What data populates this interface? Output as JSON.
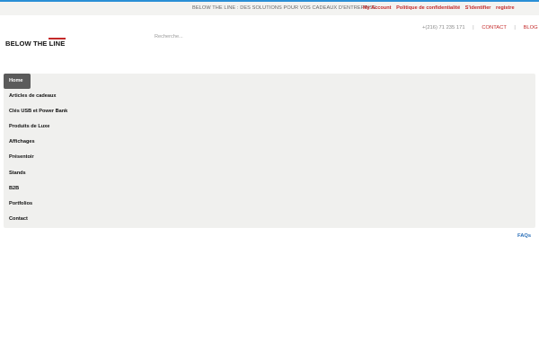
{
  "topbar": {
    "tagline": "BELOW THE LINE : DES SOLUTIONS POUR VOS CADEAUX D'ENTREPRISE",
    "links": [
      "My Account",
      "Politique de confidentialité",
      "S'identifier",
      "registre"
    ]
  },
  "header": {
    "logo_text": "BELOW THE LINE",
    "search_placeholder": "Recherche...",
    "phone": "+(216) 71 235 171",
    "contact_label": "CONTACT",
    "blog_label": "BLOG",
    "separators": [
      "|",
      "|"
    ]
  },
  "menu": {
    "items": [
      "Home",
      "Articles de cadeaux",
      "Clés USB et Power Bank",
      "Produits de Luxe",
      "Affichages",
      "Présentoir",
      "Stands",
      "B2B",
      "Portfolios",
      "Contact"
    ],
    "active": "Home"
  },
  "footer": {
    "faq_label": "FAQs"
  },
  "colors": {
    "accent_blue": "#2a8fd6",
    "link_red": "#c42a2a",
    "menu_bg": "#f0f0ee",
    "active_bg": "#5b5b5b"
  }
}
